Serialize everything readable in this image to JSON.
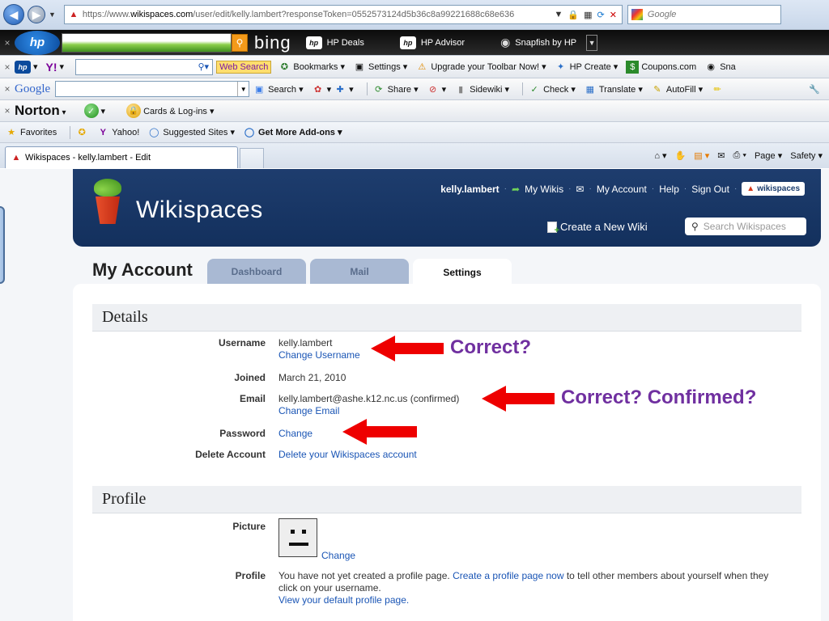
{
  "browser": {
    "address_scheme": "https://www.",
    "address_domain": "wikispaces.com",
    "address_path": "/user/edit/kelly.lambert?responseToken=0552573124d5b36c8a99221688c68e636",
    "search_placeholder": "Google",
    "hp_bar": {
      "bing": "bing",
      "items": [
        "HP Deals",
        "HP Advisor",
        "Snapfish by HP"
      ]
    },
    "yahoo_bar": {
      "yahoo": "Y!",
      "web_search": "Web Search",
      "items": [
        "Bookmarks ▾",
        "Settings ▾",
        "Upgrade your Toolbar Now! ▾",
        "HP Create ▾",
        "Coupons.com",
        "Sna"
      ]
    },
    "google_bar": {
      "logo": "Google",
      "items": [
        "Search ▾",
        "Share ▾",
        "Sidewiki ▾",
        "Check ▾",
        "Translate ▾",
        "AutoFill ▾"
      ]
    },
    "norton_bar": {
      "logo": "Norton",
      "cards": "Cards & Log-ins ▾"
    },
    "favorites_bar": {
      "favorites": "Favorites",
      "yahoo": "Yahoo!",
      "suggested": "Suggested Sites ▾",
      "addons": "Get More Add-ons ▾"
    },
    "tab_title": "Wikispaces - kelly.lambert - Edit",
    "cmd": {
      "page": "Page ▾",
      "safety": "Safety ▾"
    }
  },
  "site": {
    "title": "Wikispaces",
    "nav": {
      "user": "kelly.lambert",
      "my_wikis": "My Wikis",
      "my_account": "My Account",
      "help": "Help",
      "sign_out": "Sign Out",
      "badge": "wikispaces"
    },
    "create_wiki": "Create a New Wiki",
    "search_placeholder": "Search Wikispaces"
  },
  "account": {
    "title": "My Account",
    "tabs": [
      "Dashboard",
      "Mail",
      "Settings"
    ],
    "active_tab": "Settings"
  },
  "details": {
    "heading": "Details",
    "username_label": "Username",
    "username": "kelly.lambert",
    "change_username": "Change Username",
    "joined_label": "Joined",
    "joined": "March 21, 2010",
    "email_label": "Email",
    "email": "kelly.lambert@ashe.k12.nc.us (confirmed)",
    "change_email": "Change Email",
    "password_label": "Password",
    "password_change": "Change",
    "delete_label": "Delete Account",
    "delete_link": "Delete your Wikispaces account"
  },
  "profile": {
    "heading": "Profile",
    "picture_label": "Picture",
    "picture_change": "Change",
    "profile_label": "Profile",
    "profile_text_1": "You have not yet created a profile page.",
    "profile_link": "Create a profile page now",
    "profile_text_2": "to tell other members about yourself when they click on your username.",
    "view_default": "View your default profile page."
  },
  "annotations": {
    "note1": "Correct?",
    "note2": "Correct?  Confirmed?"
  },
  "colors": {
    "header_blue": "#13305d",
    "link": "#1a55b5",
    "annotation_arrow": "#ee0000",
    "annotation_text": "#7030a0"
  }
}
